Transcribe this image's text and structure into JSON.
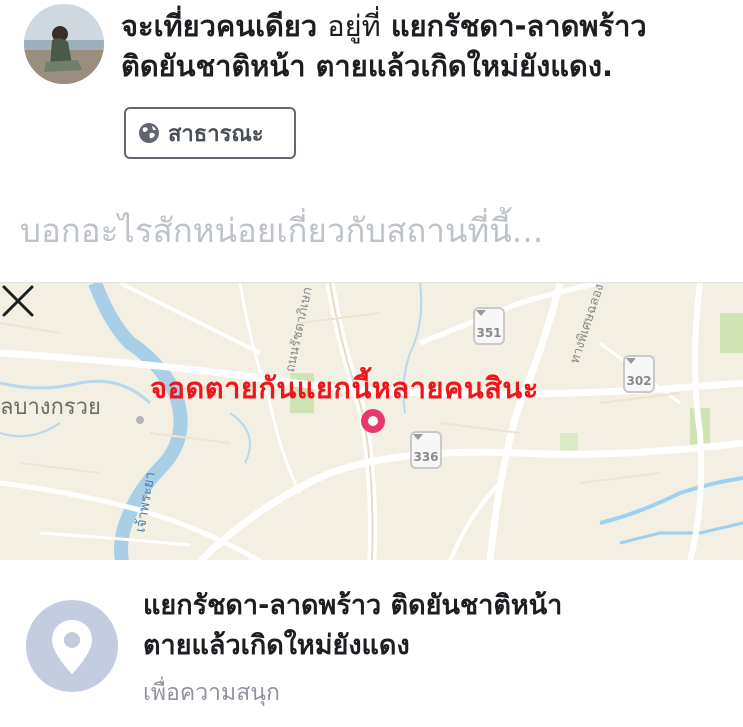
{
  "post": {
    "author_status": "จะเที่ยวคนเดียว",
    "at_text": "อยู่ที่",
    "location_line1": "แยกรัชดา-ลาดพร้าว",
    "location_line2": "ติดยันชาติหน้า ตายแล้วเกิดใหม่ยังแดง."
  },
  "privacy": {
    "label": "สาธารณะ",
    "icon": "globe-icon"
  },
  "composer": {
    "placeholder": "บอกอะไรสักหน่อยเกี่ยวกับสถานที่นี้..."
  },
  "map": {
    "caption": "จอดตายกันแยกนี้หลายคนสินะ",
    "district_label": "ลบางกรวย",
    "road_labels": [
      "ถนนรัชดาภิเษก",
      "ทางพิเศษฉลอง",
      "เจ้าพระยา"
    ],
    "route_numbers": [
      "351",
      "336",
      "302"
    ],
    "close_icon": "close-icon",
    "pin_color": "#e8386c"
  },
  "place": {
    "name_line1": "แยกรัชดา-ลาดพร้าว ติดยันชาติหน้า",
    "name_line2": "ตายแล้วเกิดใหม่ยังแดง",
    "category": "เพื่อความสนุก",
    "icon": "location-pin-icon"
  }
}
